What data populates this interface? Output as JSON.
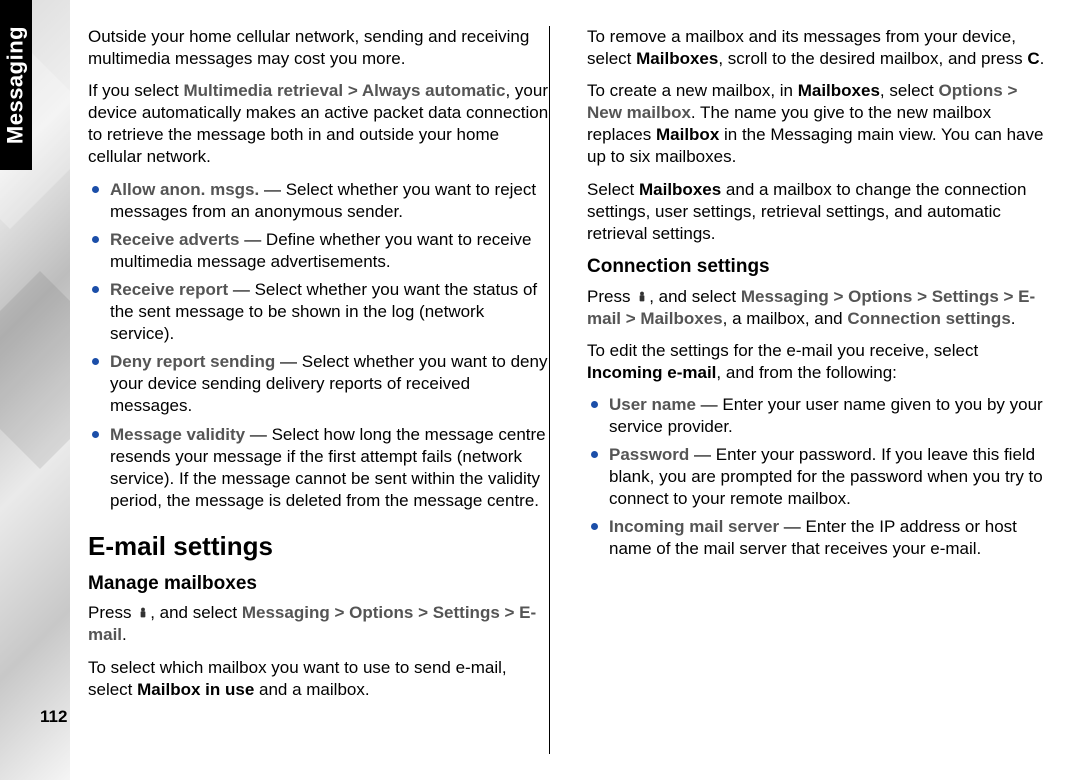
{
  "sideTab": "Messaging",
  "pageNumber": "112",
  "col1": {
    "p1": "Outside your home cellular network, sending and receiving multimedia messages may cost you more.",
    "p2a": "If you select ",
    "p2b": "Multimedia retrieval",
    "p2c": "Always automatic",
    "p2d": ", your device automatically makes an active packet data connection to retrieve the message both in and outside your home cellular network.",
    "bullets": [
      {
        "term": "Allow anon. msgs.",
        "desc": " — Select whether you want to reject messages from an anonymous sender."
      },
      {
        "term": "Receive adverts",
        "desc": " — Define whether you want to receive multimedia message advertisements."
      },
      {
        "term": "Receive report",
        "desc": " — Select whether you want the status of the sent message to be shown in the log (network service)."
      },
      {
        "term": "Deny report sending",
        "desc": " — Select whether you want to deny your device sending delivery reports of received messages."
      },
      {
        "term": "Message validity",
        "desc": " — Select how long the message centre resends your message if the first attempt fails (network service). If the message cannot be sent within the validity period, the message is deleted from the message centre."
      }
    ],
    "h2": "E-mail settings",
    "h3": "Manage mailboxes",
    "p3a": "Press ",
    "p3b": ", and select ",
    "p3c": "Messaging",
    "p3d": "Options",
    "p3e": "Settings",
    "p3f": "E-mail",
    "p3g": "."
  },
  "col2": {
    "p1a": "To select which mailbox you want to use to send e-mail, select ",
    "p1b": "Mailbox in use",
    "p1c": " and a mailbox.",
    "p2a": "To remove a mailbox and its messages from your device, select ",
    "p2b": "Mailboxes",
    "p2c": ", scroll to the desired mailbox, and press ",
    "p2d": "C",
    "p2e": ".",
    "p3a": "To create a new mailbox, in ",
    "p3b": "Mailboxes",
    "p3c": ", select ",
    "p3d": "Options",
    "p3e": "New mailbox",
    "p3f": ". The name you give to the new mailbox replaces ",
    "p3g": "Mailbox",
    "p3h": " in the Messaging main view. You can have up to six mailboxes.",
    "p4a": "Select ",
    "p4b": "Mailboxes",
    "p4c": " and a mailbox to change the connection settings, user settings, retrieval settings, and automatic retrieval settings.",
    "h3": "Connection settings",
    "p5a": "Press ",
    "p5b": ", and select ",
    "p5c": "Messaging",
    "p5d": "Options",
    "p5e": "Settings",
    "p5f": "E-mail",
    "p5g": "Mailboxes",
    "p5h": ", a mailbox, and ",
    "p5i": "Connection settings",
    "p5j": ".",
    "p6a": "To edit the settings for the e-mail you receive, select ",
    "p6b": "Incoming e-mail",
    "p6c": ", and from the following:",
    "bullets": [
      {
        "term": "User name",
        "desc": " — Enter your user name given to you by your service provider."
      },
      {
        "term": "Password",
        "desc": " — Enter your password. If you leave this field blank, you are prompted for the password when you try to connect to your remote mailbox."
      },
      {
        "term": "Incoming mail server",
        "desc": " — Enter the IP address or host name of the mail server that receives your e-mail."
      }
    ]
  }
}
